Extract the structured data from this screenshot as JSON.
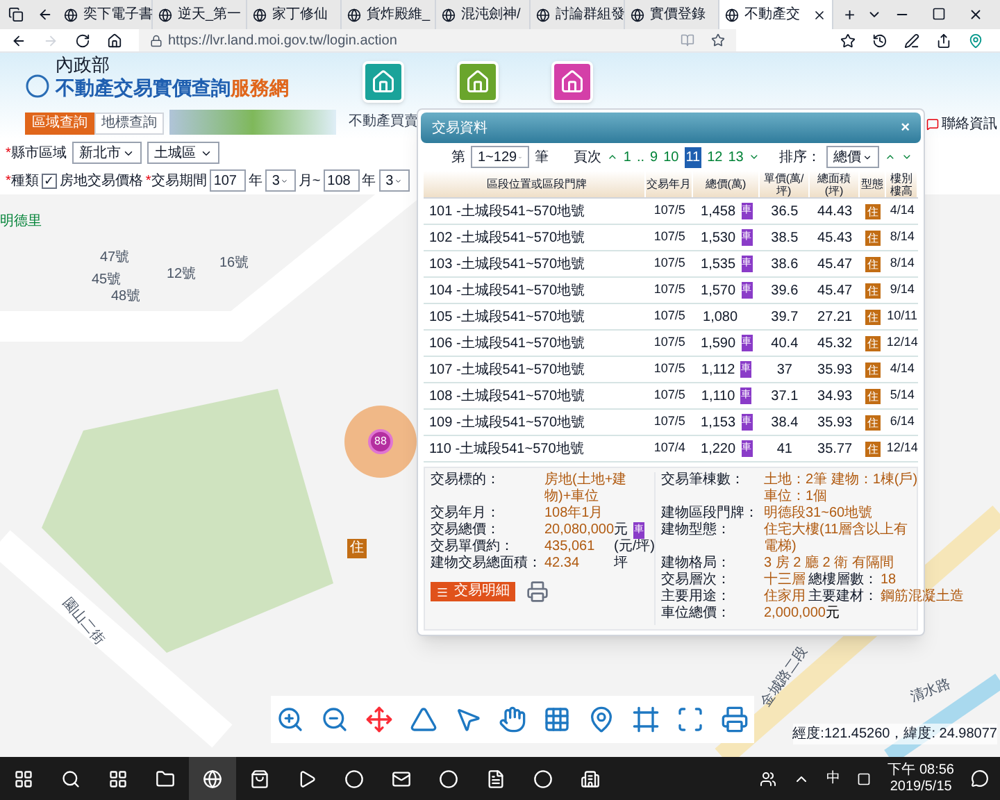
{
  "browser": {
    "tabs": [
      {
        "label": "奕下電子書",
        "selected": false
      },
      {
        "label": "逆天_第一",
        "selected": false
      },
      {
        "label": "家丁修仙",
        "selected": false
      },
      {
        "label": "貨炸殿維_",
        "selected": false
      },
      {
        "label": "混沌劍神/",
        "selected": false
      },
      {
        "label": "討論群組發",
        "selected": false
      },
      {
        "label": "實價登錄",
        "selected": false
      },
      {
        "label": "不動產交",
        "selected": true
      }
    ],
    "new_tab": "+",
    "url": "https://lvr.land.moi.gov.tw/login.action"
  },
  "header": {
    "ministry": "內政部",
    "site_title": "不動產交易實價查詢",
    "site_title_accent": "服務網",
    "nav": [
      {
        "label": "不動產買賣",
        "color": "#1aa39a"
      },
      {
        "color": "#6aa52c"
      },
      {
        "color": "#d43fa8"
      }
    ],
    "tabs": [
      {
        "label": "區域查詢",
        "selected": true
      },
      {
        "label": "地標查詢",
        "selected": false
      }
    ],
    "contact": "聯絡資訊"
  },
  "filters": {
    "required_mark": "*",
    "check_mark": "✓",
    "region_label": "縣市區域",
    "city": "新北市",
    "district": "土城區",
    "type_label": "種類",
    "type_option": {
      "label": "房地交易價格",
      "checked": true
    },
    "period_label": "交易期間",
    "from_year": "107",
    "year_unit": "年",
    "from_month": "3",
    "month_unit": "月~",
    "to_year": "108",
    "to_year_unit": "年",
    "to_month": "3"
  },
  "map": {
    "labels": [
      "明德里",
      "47號",
      "45號",
      "12號",
      "48號",
      "16號",
      "園山二街",
      "金城路二段",
      "清水路"
    ],
    "cluster": "88",
    "marker": "住",
    "coordinates": "經度:121.45260，緯度: 24.98077"
  },
  "popup": {
    "title": "交易資料",
    "close": "×",
    "record_prefix": "第",
    "record_range": "1~129",
    "record_suffix": "筆",
    "page_label": "頁次",
    "pages": [
      {
        "label": "1",
        "selected": false
      },
      {
        "label": "..",
        "selected": false
      },
      {
        "label": "9",
        "selected": false
      },
      {
        "label": "10",
        "selected": false
      },
      {
        "label": "11",
        "selected": true
      },
      {
        "label": "12",
        "selected": false
      },
      {
        "label": "13",
        "selected": false
      }
    ],
    "sort_label": "排序：",
    "sort_value": "總價",
    "columns": [
      "區段位置或區段門牌",
      "交易年月",
      "總價(萬)",
      "單價(萬/坪)",
      "總面積(坪)",
      "型態",
      "樓別樓高"
    ],
    "rows": [
      {
        "address": "101 -土城段541~570地號",
        "date": "107/5",
        "total": "1,458",
        "parking": "車",
        "unit": "36.5",
        "area": "44.43",
        "type": "住",
        "floor": "4/14"
      },
      {
        "address": "102 -土城段541~570地號",
        "date": "107/5",
        "total": "1,530",
        "parking": "車",
        "unit": "38.5",
        "area": "45.43",
        "type": "住",
        "floor": "8/14"
      },
      {
        "address": "103 -土城段541~570地號",
        "date": "107/5",
        "total": "1,535",
        "parking": "車",
        "unit": "38.6",
        "area": "45.47",
        "type": "住",
        "floor": "8/14"
      },
      {
        "address": "104 -土城段541~570地號",
        "date": "107/5",
        "total": "1,570",
        "parking": "車",
        "unit": "39.6",
        "area": "45.47",
        "type": "住",
        "floor": "9/14"
      },
      {
        "address": "105 -土城段541~570地號",
        "date": "107/5",
        "total": "1,080",
        "unit": "39.7",
        "area": "27.21",
        "type": "住",
        "floor": "10/11"
      },
      {
        "address": "106 -土城段541~570地號",
        "date": "107/5",
        "total": "1,590",
        "parking": "車",
        "unit": "40.4",
        "area": "45.32",
        "type": "住",
        "floor": "12/14"
      },
      {
        "address": "107 -土城段541~570地號",
        "date": "107/5",
        "total": "1,112",
        "parking": "車",
        "unit": "37",
        "area": "35.93",
        "type": "住",
        "floor": "4/14"
      },
      {
        "address": "108 -土城段541~570地號",
        "date": "107/5",
        "total": "1,110",
        "parking": "車",
        "unit": "37.1",
        "area": "34.93",
        "type": "住",
        "floor": "5/14"
      },
      {
        "address": "109 -土城段541~570地號",
        "date": "107/5",
        "total": "1,153",
        "parking": "車",
        "unit": "38.4",
        "area": "35.93",
        "type": "住",
        "floor": "6/14"
      },
      {
        "address": "110 -土城段541~570地號",
        "date": "107/4",
        "total": "1,220",
        "parking": "車",
        "unit": "41",
        "area": "35.77",
        "type": "住",
        "floor": "12/14"
      }
    ],
    "details_left": [
      {
        "label": "交易標的：",
        "value": "房地(土地+建物)+車位"
      },
      {
        "label": "交易年月：",
        "value": "108年1月"
      },
      {
        "label": "交易總價：",
        "value": "20,080,000",
        "unit": "元",
        "parking": "車"
      },
      {
        "label": "交易單價約：",
        "value": "435,061",
        "unit": "(元/坪)"
      },
      {
        "label": "建物交易總面積：",
        "value": "42.34",
        "unit": "坪"
      }
    ],
    "details_right": [
      {
        "label": "交易筆棟數：",
        "value": "土地：2筆 建物：1棟(戶) 車位：1個"
      },
      {
        "label": "建物區段門牌：",
        "value": "明德段31~60地號"
      },
      {
        "label": "建物型態：",
        "value": "住宅大樓(11層含以上有電梯)"
      },
      {
        "label": "建物格局：",
        "value": "3 房 2 廳 2 衛 有隔間"
      },
      {
        "label": "交易層次：",
        "value": "十三層",
        "extra_label": "總樓層數：",
        "extra_value": "18"
      },
      {
        "label": "主要用途：",
        "value": "住家用",
        "extra_label": "主要建材：",
        "extra_value": "鋼筋混凝土造"
      },
      {
        "label": "車位總價：",
        "value": "2,000,000",
        "unit": "元"
      }
    ],
    "detail_button": "交易明細"
  },
  "taskbar": {
    "ime": "中",
    "time": "下午 08:56",
    "date": "2019/5/15"
  }
}
